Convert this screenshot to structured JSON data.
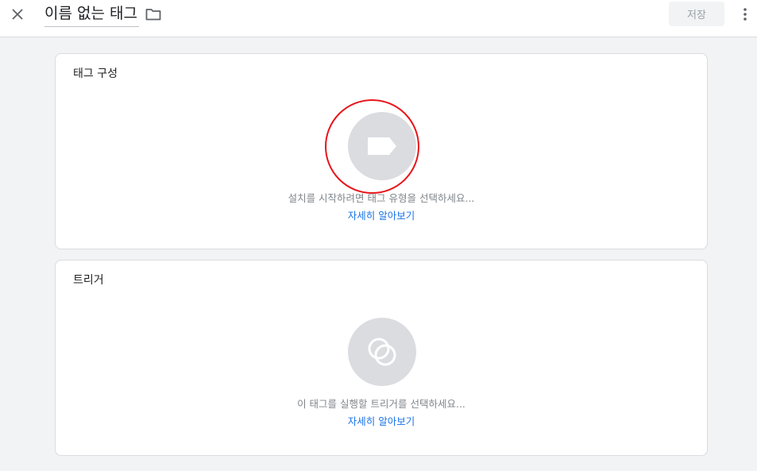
{
  "header": {
    "title": "이름 없는 태그",
    "save_label": "저장",
    "icons": {
      "close": "close-icon",
      "folder": "folder-icon",
      "more": "more-vert-icon"
    }
  },
  "tag_config": {
    "title": "태그 구성",
    "hint": "설치를 시작하려면 태그 유형을 선택하세요...",
    "learn_more": "자세히 알아보기",
    "icon": "tag-icon"
  },
  "trigger": {
    "title": "트리거",
    "hint": "이 태그를 실행할 트리거를 선택하세요...",
    "learn_more": "자세히 알아보기",
    "icon": "trigger-circles-icon"
  },
  "colors": {
    "background": "#f1f3f4",
    "card": "#ffffff",
    "link": "#1a73e8",
    "icon_circle": "#dadce0",
    "highlight_ring": "#e8151b"
  }
}
